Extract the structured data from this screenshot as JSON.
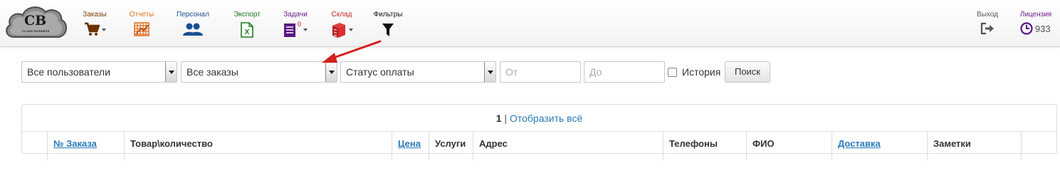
{
  "logo": {
    "text": "CB",
    "subtext": "CLOUD BUSINESS"
  },
  "nav": [
    {
      "label": "Заказы",
      "color": "#7a3e00",
      "icon": "cart-icon"
    },
    {
      "label": "Отчеты",
      "color": "#e07020",
      "icon": "grid-report-icon"
    },
    {
      "label": "Персонал",
      "color": "#1a4f8f",
      "icon": "users-icon"
    },
    {
      "label": "Экспорт",
      "color": "#1f7a1f",
      "icon": "excel-icon"
    },
    {
      "label": "Задачи",
      "color": "#6a1b8a",
      "icon": "tasks-icon",
      "badge": "0"
    },
    {
      "label": "Склад",
      "color": "#cc2222",
      "icon": "warehouse-icon"
    },
    {
      "label": "Фильтры",
      "color": "#111111",
      "icon": "filter-icon"
    }
  ],
  "right_nav": {
    "exit_label": "Выход",
    "license_label": "Лицензия",
    "license_count": "933"
  },
  "filters": {
    "users_select": "Все пользователи",
    "orders_select": "Все заказы",
    "payment_select": "Статус оплаты",
    "from_placeholder": "От",
    "to_placeholder": "До",
    "history_label": "История",
    "search_button": "Поиск"
  },
  "pager": {
    "current": "1",
    "separator": " | ",
    "show_all": "Отобразить всё"
  },
  "table": {
    "headers": [
      "№ Заказа",
      "Товар\\количество",
      "Цена",
      "Услуги",
      "Адрес",
      "Телефоны",
      "ФИО",
      "Доставка",
      "Заметки"
    ]
  },
  "colors": {
    "link": "#2a7ab8",
    "annotation_arrow": "#d42020"
  }
}
